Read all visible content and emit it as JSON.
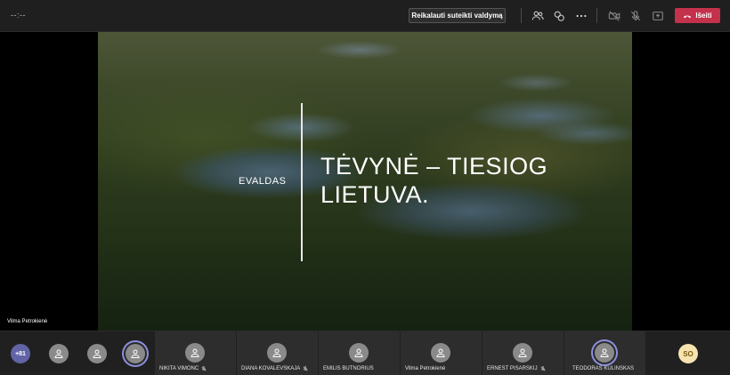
{
  "meeting": {
    "timer": "--:--"
  },
  "toolbar": {
    "request_control_label": "Reikalauti suteikti valdymą",
    "leave_label": "Išeiti",
    "icons": [
      "people-icon",
      "chat-icon",
      "more-icon",
      "camera-off-icon",
      "mic-off-icon",
      "share-tray-icon",
      "hang-up-icon"
    ]
  },
  "slide": {
    "author": "EVALDAS",
    "title": "TĖVYNĖ – TIESIOG LIETUVA."
  },
  "presenter": {
    "name": "Vilma Petrokienė"
  },
  "participants": {
    "more_count": "+81",
    "tiles": [
      {
        "name": "NIKITA VIMONC",
        "muted": true
      },
      {
        "name": "DIANA KOVALEVSKAJA",
        "muted": true
      },
      {
        "name": "EMILIS BUTNORIUS",
        "muted": false
      },
      {
        "name": "Vilma Petrokienė",
        "muted": false
      },
      {
        "name": "ERNEST PISARSKIJ",
        "muted": true
      },
      {
        "name": "TEODORAS KULINSKAS",
        "muted": false
      }
    ],
    "initials_avatar": "SO"
  },
  "colors": {
    "accent": "#6264a7",
    "leave": "#c4314b",
    "speaking_ring": "#8c8fdc"
  }
}
